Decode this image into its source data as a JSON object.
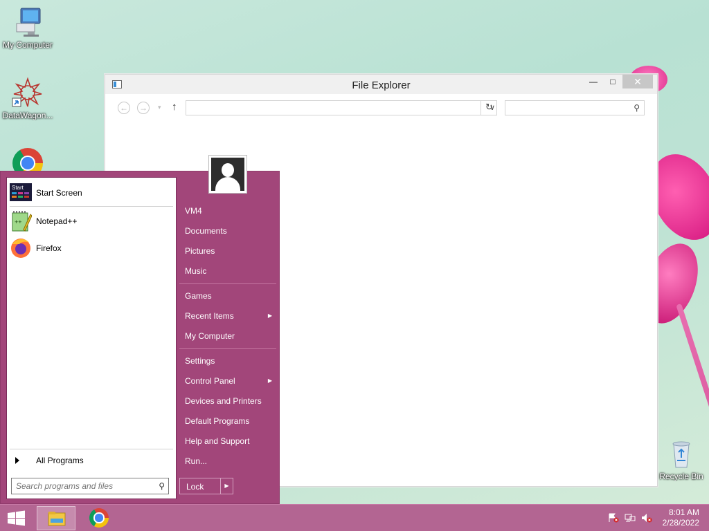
{
  "desktop": {
    "icons": [
      {
        "label": "My Computer",
        "icon": "computer-icon"
      },
      {
        "label": "DataWagon...",
        "icon": "datawagon-icon"
      },
      {
        "label": "",
        "icon": "chrome-icon"
      },
      {
        "label": "Recycle Bin",
        "icon": "recycle-bin-icon"
      }
    ]
  },
  "explorer": {
    "title": "File Explorer",
    "controls": {
      "minimize": "—",
      "maximize": "□",
      "close": "✕"
    },
    "nav": {
      "back": "←",
      "forward": "→",
      "dropdown": "▾",
      "up": "↑",
      "refresh": "↻",
      "chevron": "∨",
      "search_glyph": "⚲"
    },
    "address_value": "",
    "search_value": ""
  },
  "start_menu": {
    "pinned": [
      {
        "label": "Start Screen",
        "icon": "start-screen-icon"
      },
      {
        "label": "Notepad++",
        "icon": "notepadpp-icon"
      },
      {
        "label": "Firefox",
        "icon": "firefox-icon"
      }
    ],
    "all_programs": "All Programs",
    "search_placeholder": "Search programs and files",
    "right_items": [
      {
        "label": "VM4",
        "has_submenu": false
      },
      {
        "label": "Documents",
        "has_submenu": false
      },
      {
        "label": "Pictures",
        "has_submenu": false
      },
      {
        "label": "Music",
        "has_submenu": false
      },
      {
        "label": "Games",
        "has_submenu": false
      },
      {
        "label": "Recent Items",
        "has_submenu": true
      },
      {
        "label": "My Computer",
        "has_submenu": false
      },
      {
        "label": "Settings",
        "has_submenu": false
      },
      {
        "label": "Control Panel",
        "has_submenu": true
      },
      {
        "label": "Devices and Printers",
        "has_submenu": false
      },
      {
        "label": "Default Programs",
        "has_submenu": false
      },
      {
        "label": "Help and Support",
        "has_submenu": false
      },
      {
        "label": "Run...",
        "has_submenu": false
      }
    ],
    "submenu_arrow": "▶",
    "lock_label": "Lock",
    "lock_arrow": "▶",
    "start_screen_badge": "Start"
  },
  "taskbar": {
    "apps": [
      {
        "name": "file-explorer",
        "icon": "folder-icon",
        "active": true
      },
      {
        "name": "chrome",
        "icon": "chrome-icon",
        "active": false
      }
    ],
    "tray": {
      "time": "8:01 AM",
      "date": "2/28/2022"
    }
  },
  "colors": {
    "start_menu_bg": "#a2467a",
    "taskbar_bg": "#b36592",
    "desktop_bg": "#c9e8dc"
  }
}
